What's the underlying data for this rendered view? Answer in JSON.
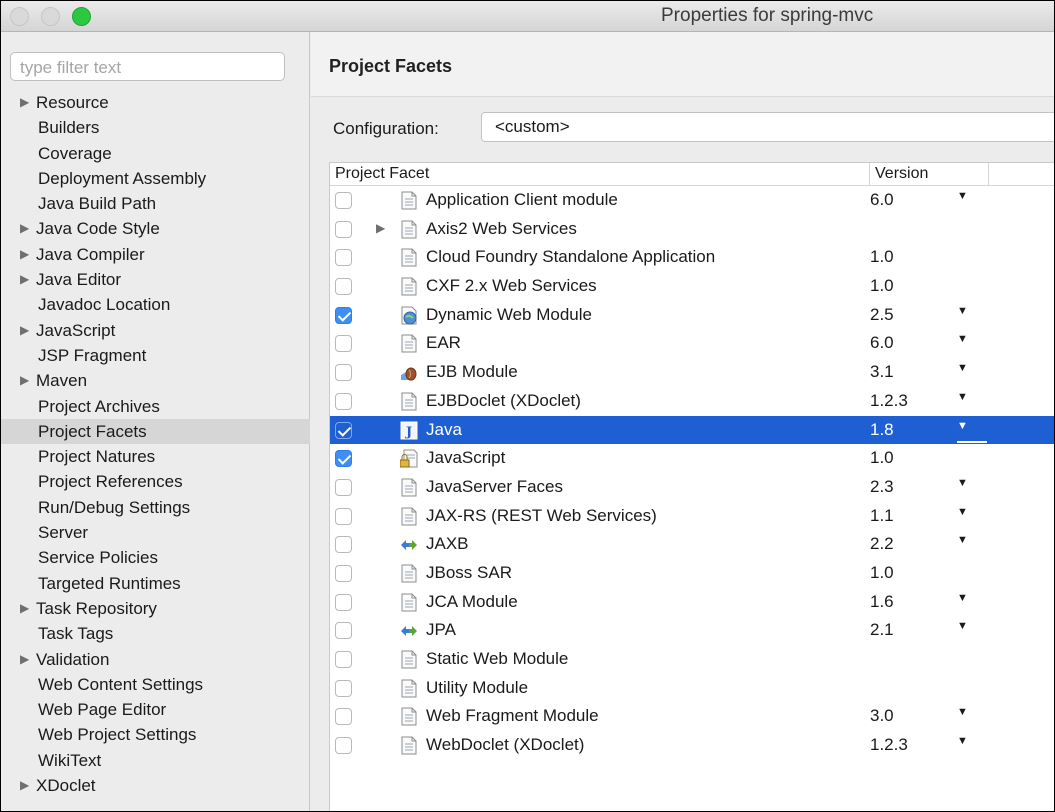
{
  "window": {
    "title": "Properties for spring-mvc"
  },
  "sidebar": {
    "filter_placeholder": "type filter text",
    "items": [
      {
        "label": "Resource",
        "arrow": true
      },
      {
        "label": "Builders"
      },
      {
        "label": "Coverage"
      },
      {
        "label": "Deployment Assembly"
      },
      {
        "label": "Java Build Path"
      },
      {
        "label": "Java Code Style",
        "arrow": true
      },
      {
        "label": "Java Compiler",
        "arrow": true
      },
      {
        "label": "Java Editor",
        "arrow": true
      },
      {
        "label": "Javadoc Location"
      },
      {
        "label": "JavaScript",
        "arrow": true
      },
      {
        "label": "JSP Fragment"
      },
      {
        "label": "Maven",
        "arrow": true
      },
      {
        "label": "Project Archives"
      },
      {
        "label": "Project Facets",
        "selected": true
      },
      {
        "label": "Project Natures"
      },
      {
        "label": "Project References"
      },
      {
        "label": "Run/Debug Settings"
      },
      {
        "label": "Server"
      },
      {
        "label": "Service Policies"
      },
      {
        "label": "Targeted Runtimes"
      },
      {
        "label": "Task Repository",
        "arrow": true
      },
      {
        "label": "Task Tags"
      },
      {
        "label": "Validation",
        "arrow": true
      },
      {
        "label": "Web Content Settings"
      },
      {
        "label": "Web Page Editor"
      },
      {
        "label": "Web Project Settings"
      },
      {
        "label": "WikiText"
      },
      {
        "label": "XDoclet",
        "arrow": true
      }
    ]
  },
  "main": {
    "title": "Project Facets",
    "configuration_label": "Configuration:",
    "configuration_value": "<custom>",
    "columns": {
      "facet": "Project Facet",
      "version": "Version"
    },
    "facets": [
      {
        "name": "Application Client module",
        "version": "6.0",
        "checked": false,
        "dropdown": true,
        "icon": "file-icon"
      },
      {
        "name": "Axis2 Web Services",
        "version": "",
        "checked": false,
        "dropdown": false,
        "icon": "file-icon",
        "expander": true
      },
      {
        "name": "Cloud Foundry Standalone Application",
        "version": "1.0",
        "checked": false,
        "dropdown": false,
        "icon": "file-icon"
      },
      {
        "name": "CXF 2.x Web Services",
        "version": "1.0",
        "checked": false,
        "dropdown": false,
        "icon": "file-icon"
      },
      {
        "name": "Dynamic Web Module",
        "version": "2.5",
        "checked": true,
        "dropdown": true,
        "icon": "globe-icon"
      },
      {
        "name": "EAR",
        "version": "6.0",
        "checked": false,
        "dropdown": true,
        "icon": "file-icon"
      },
      {
        "name": "EJB Module",
        "version": "3.1",
        "checked": false,
        "dropdown": true,
        "icon": "bean-icon"
      },
      {
        "name": "EJBDoclet (XDoclet)",
        "version": "1.2.3",
        "checked": false,
        "dropdown": true,
        "icon": "file-icon"
      },
      {
        "name": "Java",
        "version": "1.8",
        "checked": true,
        "dropdown": true,
        "icon": "java-icon",
        "selected": true
      },
      {
        "name": "JavaScript",
        "version": "1.0",
        "checked": true,
        "dropdown": false,
        "icon": "lock-file-icon"
      },
      {
        "name": "JavaServer Faces",
        "version": "2.3",
        "checked": false,
        "dropdown": true,
        "icon": "file-icon"
      },
      {
        "name": "JAX-RS (REST Web Services)",
        "version": "1.1",
        "checked": false,
        "dropdown": true,
        "icon": "file-icon"
      },
      {
        "name": "JAXB",
        "version": "2.2",
        "checked": false,
        "dropdown": true,
        "icon": "arrows-icon"
      },
      {
        "name": "JBoss SAR",
        "version": "1.0",
        "checked": false,
        "dropdown": false,
        "icon": "file-icon"
      },
      {
        "name": "JCA Module",
        "version": "1.6",
        "checked": false,
        "dropdown": true,
        "icon": "file-icon"
      },
      {
        "name": "JPA",
        "version": "2.1",
        "checked": false,
        "dropdown": true,
        "icon": "arrows-icon"
      },
      {
        "name": "Static Web Module",
        "version": "",
        "checked": false,
        "dropdown": false,
        "icon": "file-icon"
      },
      {
        "name": "Utility Module",
        "version": "",
        "checked": false,
        "dropdown": false,
        "icon": "file-icon"
      },
      {
        "name": "Web Fragment Module",
        "version": "3.0",
        "checked": false,
        "dropdown": true,
        "icon": "file-icon"
      },
      {
        "name": "WebDoclet (XDoclet)",
        "version": "1.2.3",
        "checked": false,
        "dropdown": true,
        "icon": "file-icon"
      }
    ]
  }
}
